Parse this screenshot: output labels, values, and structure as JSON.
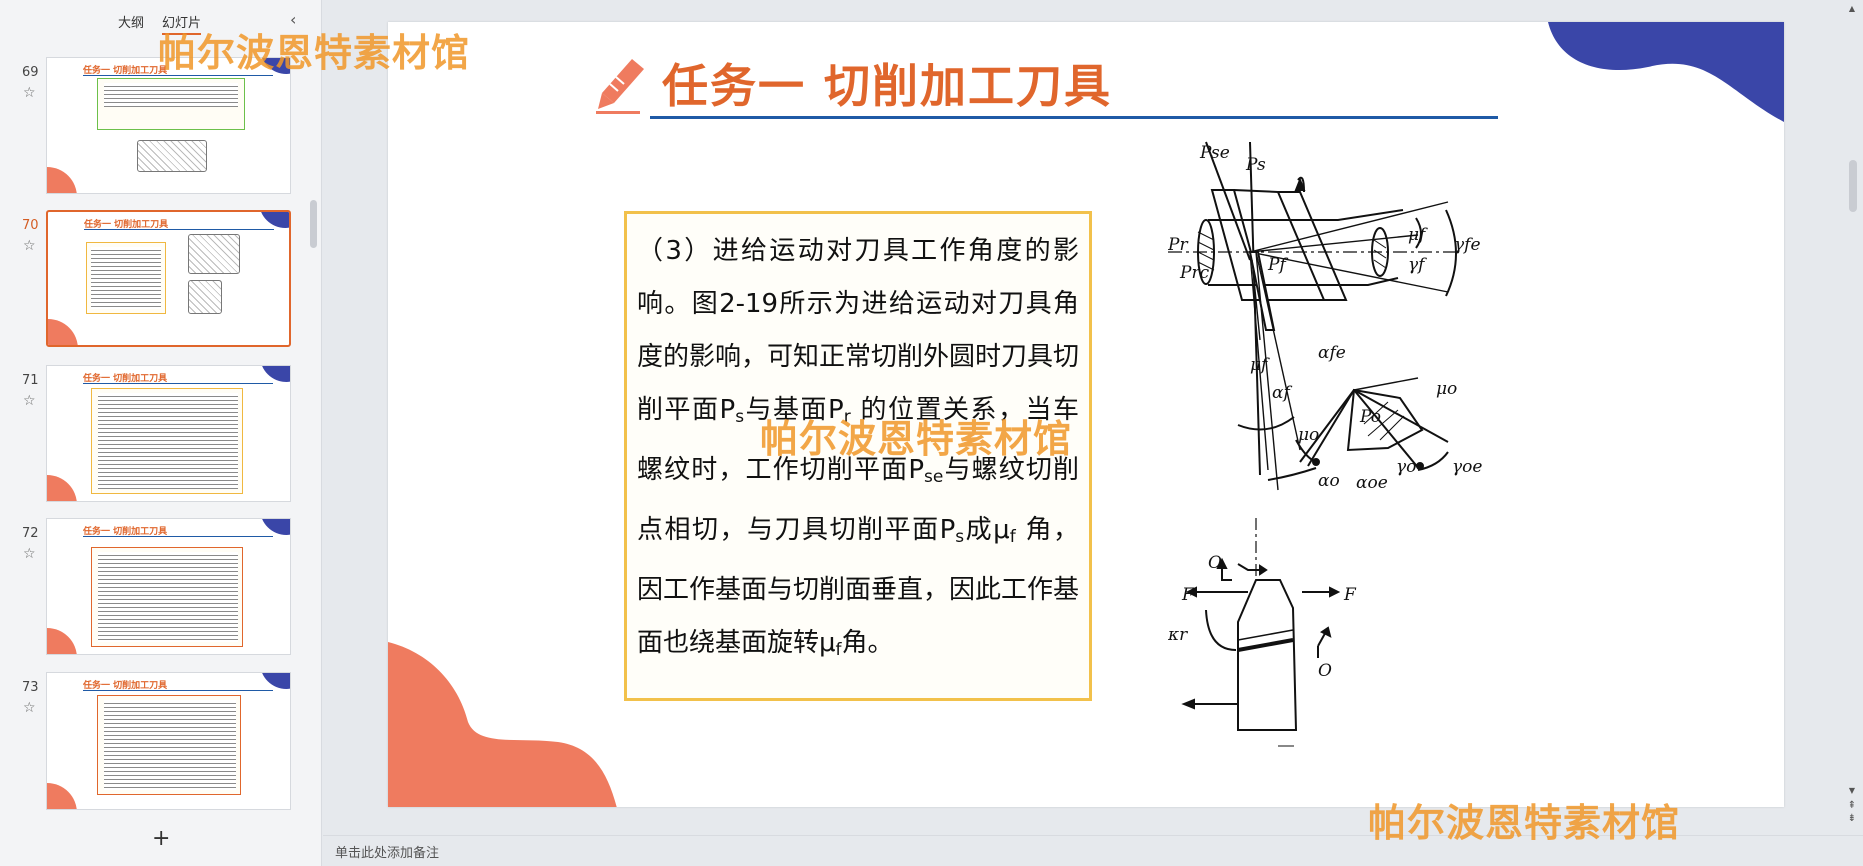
{
  "panel": {
    "tabs": [
      "大纲",
      "幻灯片"
    ],
    "active_tab": "幻灯片",
    "collapse_icon": "‹",
    "add_icon": "+"
  },
  "thumbnails": [
    {
      "number": "69",
      "title": "任务一 切削加工刀具"
    },
    {
      "number": "70",
      "title": "任务一 切削加工刀具",
      "active": true
    },
    {
      "number": "71",
      "title": "任务一 切削加工刀具"
    },
    {
      "number": "72",
      "title": "任务一 切削加工刀具"
    },
    {
      "number": "73",
      "title": "任务一 切削加工刀具"
    }
  ],
  "slide": {
    "title": "任务一  切削加工刀具",
    "body": {
      "p1": "（3）进给运动对刀具工作角度的影响。图2-19所示为进给运动对刀具角度的影响，可知正常切削外圆时刀具切削平面P",
      "sub_s1": "s",
      "p2": "与基面P",
      "sub_r1": "r",
      "p3": " 的位置关系，当车螺纹时，工作切削平面P",
      "sub_se": "se",
      "p4": "与螺纹切削点相切，与刀具切削平面P",
      "sub_s2": "s",
      "p5": "成μ",
      "sub_f1": "f",
      "p6": " 角，因工作基面与切削面垂直，因此工作基面也绕基面旋转μ",
      "sub_f2": "f",
      "p7": "角。"
    },
    "figure_labels": {
      "Pse": "Pse",
      "Ps": "Ps",
      "Pr": "Pr",
      "Prc": "Prc",
      "Pf": "Pf",
      "mu_f": "μf",
      "gamma_f": "γf",
      "gamma_fe": "γfe",
      "alpha_fe": "αfe",
      "alpha_f": "αf",
      "mu_f2": "μf",
      "Po": "Po",
      "mu_o": "μo",
      "mu_o2": "μo",
      "alpha_o": "αo",
      "alpha_oe": "αoe",
      "gamma_o": "γo",
      "gamma_oe": "γoe",
      "O1": "O",
      "O2": "O",
      "F1": "F",
      "F2": "F",
      "kappa_r": "κr"
    }
  },
  "notes_placeholder": "单击此处添加备注",
  "watermark": "帕尔波恩特素材馆",
  "colors": {
    "accent_orange": "#e0662c",
    "title_blue": "#1f5aa6",
    "blob_navy": "#3a46a8",
    "blob_coral": "#ef7b5f",
    "box_border": "#f2c14b"
  }
}
